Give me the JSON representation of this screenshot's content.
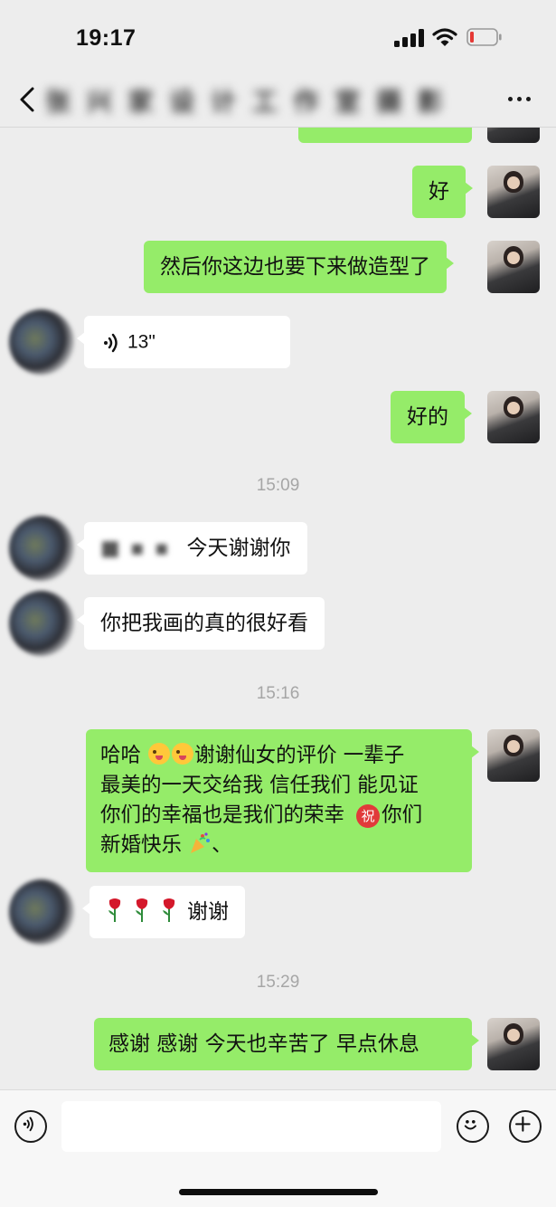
{
  "status_bar": {
    "time": "19:17"
  },
  "header": {
    "title": "张 兴 家 设 计 工 作 室 摄 影"
  },
  "messages": {
    "m1": "好",
    "m2": "然后你这边也要下来做造型了",
    "voice_duration": "13\"",
    "m4": "好的",
    "time1": "15:09",
    "m5_name": "■ ▪ ▪",
    "m5": "今天谢谢你",
    "m6": "你把我画的真的很好看",
    "time2": "15:16",
    "m7_line1_a": "哈哈 ",
    "m7_line1_b": "谢谢仙女的评价  一辈子",
    "m7_line2": "最美的一天交给我  信任我们  能见证",
    "m7_line3": "你们的幸福也是我们的荣幸 ",
    "m7_zhu": "祝",
    "m7_line3_end": "你们",
    "m7_line4": "新婚快乐 ",
    "m7_line4_end": "、",
    "m8": "谢谢",
    "time3": "15:29",
    "m9": "感谢  感谢   今天也辛苦了   早点休息"
  },
  "input": {
    "placeholder": ""
  },
  "icons": {
    "back": "chevron-left-icon",
    "more": "more-icon",
    "voice": "voice-icon",
    "emoji": "emoji-icon",
    "add": "plus-icon"
  },
  "colors": {
    "outgoing_bubble": "#95ec69",
    "incoming_bubble": "#ffffff",
    "background": "#ededed",
    "battery_low": "#e53935"
  }
}
